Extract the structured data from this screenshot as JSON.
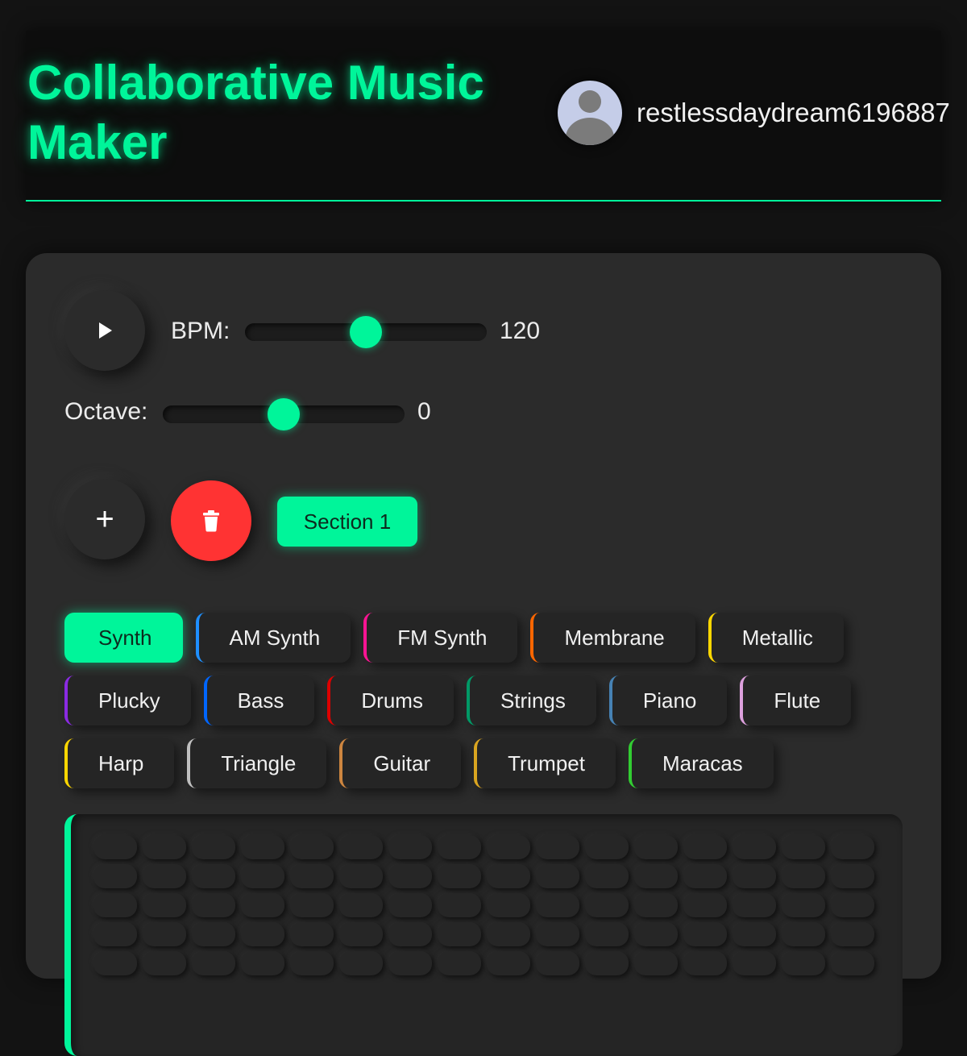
{
  "header": {
    "title": "Collaborative Music Maker",
    "username": "restlessdaydream6196887"
  },
  "controls": {
    "bpm_label": "BPM:",
    "bpm_value": "120",
    "bpm_fraction": 0.5,
    "octave_label": "Octave:",
    "octave_value": "0",
    "octave_fraction": 0.5,
    "add_section": "+",
    "section_label": "Section 1"
  },
  "instruments": [
    {
      "name": "Synth",
      "color": "#00f59a",
      "active": true
    },
    {
      "name": "AM Synth",
      "color": "#1e90ff"
    },
    {
      "name": "FM Synth",
      "color": "#ff1493"
    },
    {
      "name": "Membrane",
      "color": "#ff6600"
    },
    {
      "name": "Metallic",
      "color": "#ffd700"
    },
    {
      "name": "Plucky",
      "color": "#8a2be2"
    },
    {
      "name": "Bass",
      "color": "#0066ff"
    },
    {
      "name": "Drums",
      "color": "#dd0000"
    },
    {
      "name": "Strings",
      "color": "#009966"
    },
    {
      "name": "Piano",
      "color": "#4682b4"
    },
    {
      "name": "Flute",
      "color": "#dda0dd"
    },
    {
      "name": "Harp",
      "color": "#ffd700"
    },
    {
      "name": "Triangle",
      "color": "#c0c0c0"
    },
    {
      "name": "Guitar",
      "color": "#cd853f"
    },
    {
      "name": "Trumpet",
      "color": "#daa520"
    },
    {
      "name": "Maracas",
      "color": "#32cd32"
    }
  ],
  "sequencer": {
    "steps": 16,
    "rows": 5
  }
}
